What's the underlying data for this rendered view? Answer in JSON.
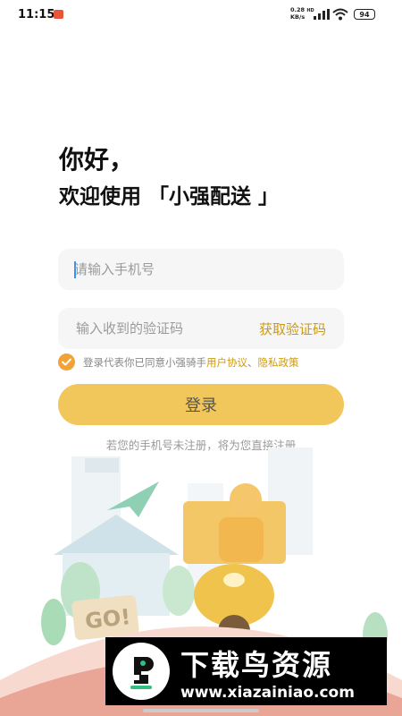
{
  "status_bar": {
    "time": "11:15",
    "net_speed": "0.28",
    "net_unit": "KB/s",
    "net_type": "HD",
    "battery": "94"
  },
  "greeting": "你好，",
  "welcome": "欢迎使用 「小强配送 」",
  "phone_input": {
    "placeholder": "请输入手机号",
    "value": ""
  },
  "code_input": {
    "placeholder": "输入收到的验证码",
    "value": ""
  },
  "get_code_label": "获取验证码",
  "agreement": {
    "prefix": "登录代表你已同意小强骑手",
    "user_agreement": "用户协议",
    "separator": "、",
    "privacy_policy": "隐私政策",
    "checked": true
  },
  "login_label": "登录",
  "register_hint": "若您的手机号未注册，将为您直接注册",
  "illustration_sign": "GO!",
  "watermark": {
    "title": "下载鸟资源",
    "url": "www.xiazainiao.com"
  },
  "colors": {
    "accent": "#f1c65a",
    "link": "#cc9a12",
    "check": "#f1a33a"
  }
}
